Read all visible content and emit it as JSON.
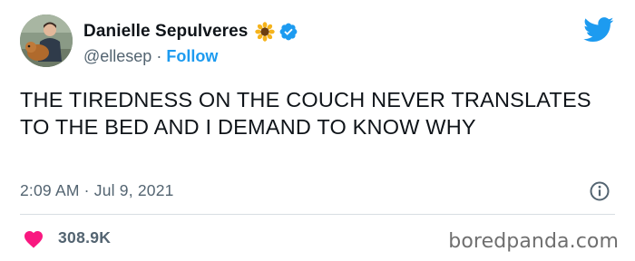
{
  "tweet": {
    "display_name": "Danielle Sepulveres",
    "name_emoji": "🌻",
    "verified_icon": "verified-badge-icon",
    "handle": "@ellesep",
    "separator": "·",
    "follow_label": "Follow",
    "text": "THE TIREDNESS ON THE COUCH NEVER TRANSLATES TO THE BED AND I DEMAND TO KNOW WHY",
    "timestamp": "2:09 AM · Jul 9, 2021",
    "likes": "308.9K"
  },
  "icons": {
    "brand": "twitter-bird-icon",
    "info": "info-icon",
    "like": "heart-icon"
  },
  "watermark": "boredpanda.com",
  "colors": {
    "accent": "#1d9bf0",
    "heart": "#f91880",
    "muted_text": "#536471",
    "main_text": "#0f1419"
  }
}
